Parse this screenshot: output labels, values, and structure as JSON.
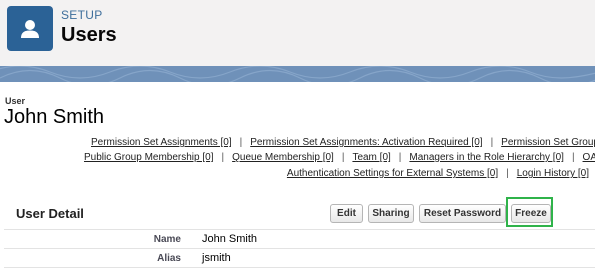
{
  "header": {
    "section": "SETUP",
    "title": "Users",
    "icon": "user-icon",
    "icon_color": "#2b6296"
  },
  "record": {
    "type_label": "User",
    "name": "John Smith"
  },
  "related_links": {
    "row1": [
      "Permission Set Assignments [0]",
      "Permission Set Assignments: Activation Required [0]",
      "Permission Set Group"
    ],
    "row2": [
      "Public Group Membership [0]",
      "Queue Membership [0]",
      "Team [0]",
      "Managers in the Role Hierarchy [0]",
      "OA"
    ],
    "row3": [
      "Authentication Settings for External Systems [0]",
      "Login History [0]"
    ]
  },
  "detail": {
    "title": "User Detail",
    "buttons": {
      "edit": "Edit",
      "sharing": "Sharing",
      "reset_password": "Reset Password",
      "freeze": "Freeze"
    },
    "highlight_color": "#2fb34a",
    "fields": [
      {
        "label": "Name",
        "value": "John Smith"
      },
      {
        "label": "Alias",
        "value": "jsmith"
      }
    ]
  }
}
